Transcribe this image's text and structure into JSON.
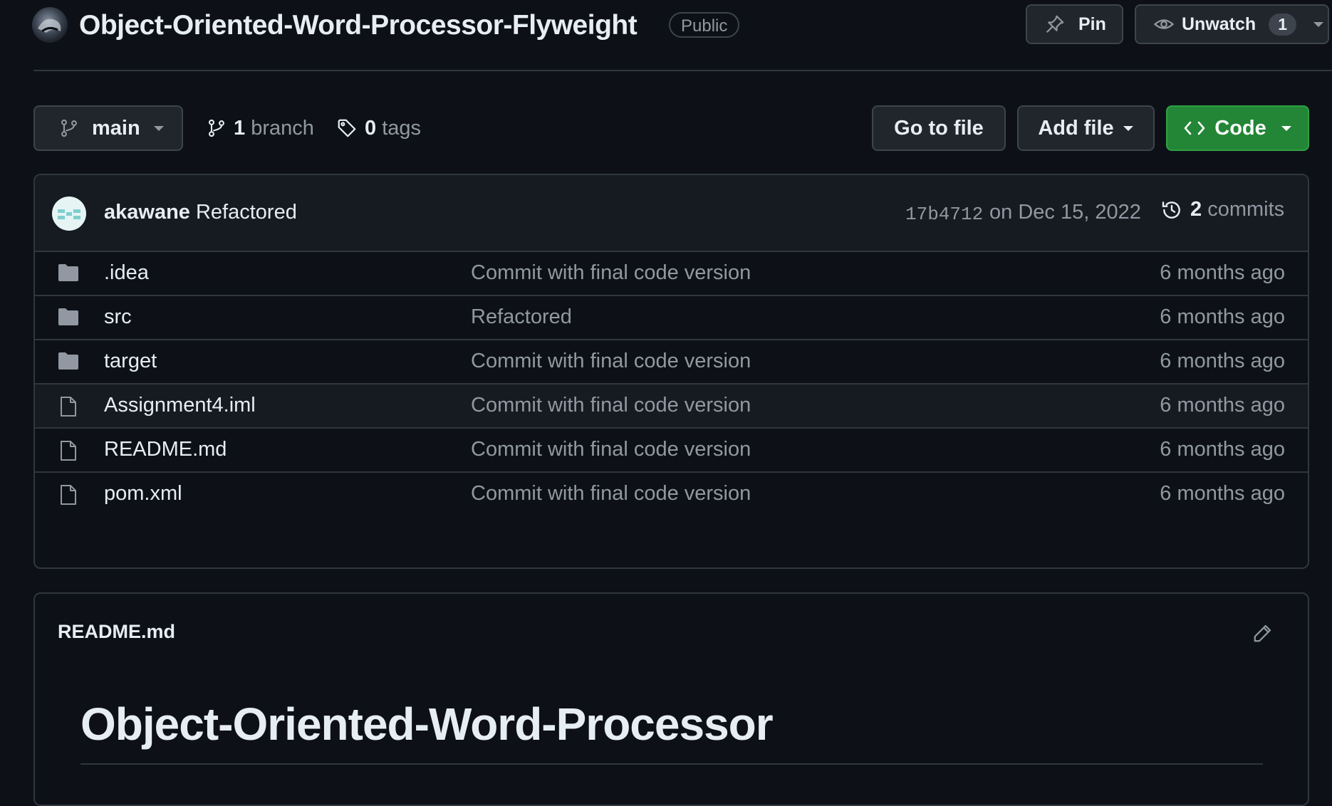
{
  "repo": {
    "title": "Object-Oriented-Word-Processor-Flyweight",
    "visibility": "Public",
    "pin_label": "Pin",
    "watch_label": "Unwatch",
    "watch_count": "1"
  },
  "toolbar": {
    "branch": "main",
    "branch_count": "1",
    "branch_word": "branch",
    "tag_count": "0",
    "tag_word": "tags",
    "go_to_file": "Go to file",
    "add_file": "Add file",
    "code": "Code"
  },
  "commit": {
    "author": "akawane",
    "message": "Refactored",
    "sha": "17b4712",
    "date": "on Dec 15, 2022",
    "count": "2",
    "count_word": "commits"
  },
  "files": [
    {
      "type": "folder",
      "name": ".idea",
      "message": "Commit with final code version",
      "age": "6 months ago"
    },
    {
      "type": "folder",
      "name": "src",
      "message": "Refactored",
      "age": "6 months ago"
    },
    {
      "type": "folder",
      "name": "target",
      "message": "Commit with final code version",
      "age": "6 months ago"
    },
    {
      "type": "file",
      "name": "Assignment4.iml",
      "message": "Commit with final code version",
      "age": "6 months ago"
    },
    {
      "type": "file",
      "name": "README.md",
      "message": "Commit with final code version",
      "age": "6 months ago"
    },
    {
      "type": "file",
      "name": "pom.xml",
      "message": "Commit with final code version",
      "age": "6 months ago"
    }
  ],
  "readme": {
    "filename": "README.md",
    "heading": "Object-Oriented-Word-Processor"
  },
  "colors": {
    "background": "#0d1117",
    "border": "#30363d",
    "code_button": "#238636",
    "muted_text": "#9198a1"
  }
}
